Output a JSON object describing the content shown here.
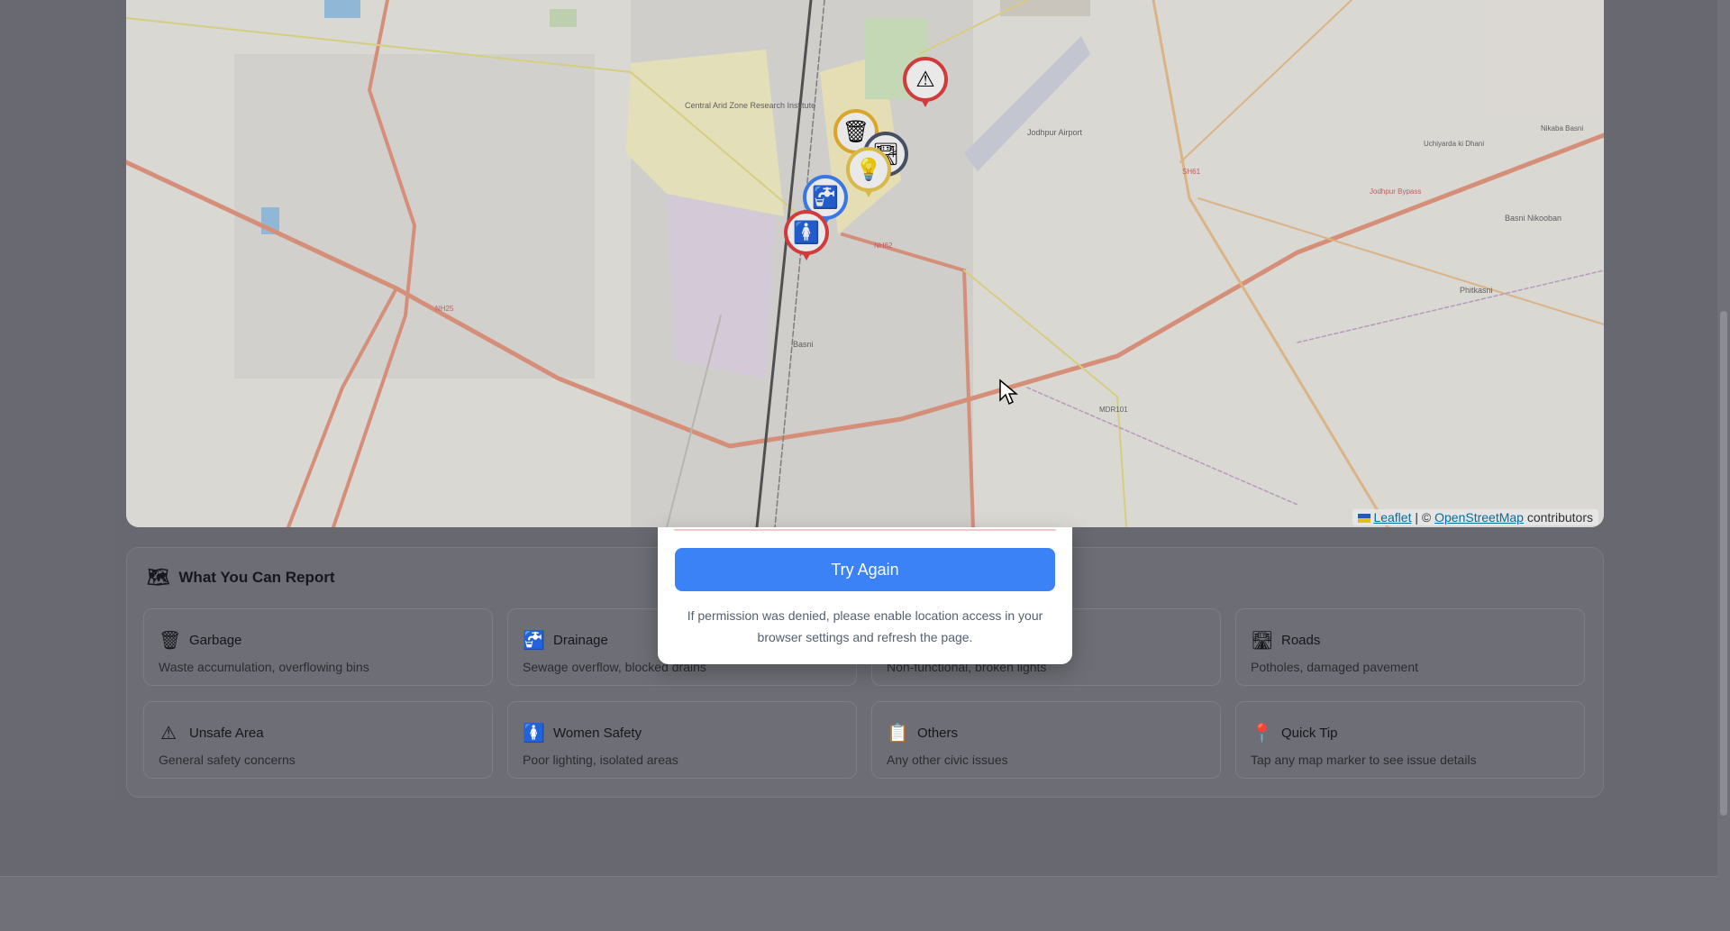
{
  "map": {
    "attribution": {
      "leaflet": "Leaflet",
      "separator": "| ©",
      "osm": "OpenStreetMap",
      "suffix": "contributors"
    },
    "place_labels": {
      "cazri": "Central Arid Zone Research Institute",
      "airport": "Jodhpur Airport",
      "basni": "Basni",
      "basni_nikooban": "Basni Nikooban",
      "phitkasni": "Phitkasni",
      "nikaba": "Nikaba Basni",
      "uchiyarda": "Uchiyarda ki Dhani",
      "jodhpur_bypass": "Jodhpur Bypass",
      "nh25": "NH25",
      "nh62": "NH62",
      "sh61": "SH61",
      "mdr101": "MDR101"
    },
    "markers": [
      {
        "name": "unsafe-area-marker",
        "glyph": "⚠",
        "color": "#e53e3e"
      },
      {
        "name": "garbage-marker",
        "glyph": "🗑",
        "color": "#f0b429"
      },
      {
        "name": "roads-marker",
        "glyph": "🛣",
        "color": "#4a5568"
      },
      {
        "name": "streetlight-marker",
        "glyph": "💡",
        "color": "#ecc94b"
      },
      {
        "name": "drainage-marker",
        "glyph": "🚰",
        "color": "#3b82f6"
      },
      {
        "name": "women-safety-marker",
        "glyph": "🚺",
        "color": "#e53e3e"
      }
    ]
  },
  "modal": {
    "button_label": "Try Again",
    "note": "If permission was denied, please enable location access in your browser settings and refresh the page."
  },
  "report": {
    "title": "What You Can Report",
    "title_icon": "map-icon",
    "cards": [
      {
        "icon": "garbage-icon",
        "glyph": "🗑",
        "title": "Garbage",
        "desc": "Waste accumulation, overflowing bins"
      },
      {
        "icon": "drainage-icon",
        "glyph": "🚰",
        "title": "Drainage",
        "desc": "Sewage overflow, blocked drains"
      },
      {
        "icon": "streetlight-icon",
        "glyph": "💡",
        "title": "",
        "desc": "Non-functional, broken lights"
      },
      {
        "icon": "roads-icon",
        "glyph": "🛣",
        "title": "Roads",
        "desc": "Potholes, damaged pavement"
      },
      {
        "icon": "warning-icon",
        "glyph": "⚠",
        "title": "Unsafe Area",
        "desc": "General safety concerns"
      },
      {
        "icon": "women-safety-icon",
        "glyph": "🚺",
        "title": "Women Safety",
        "desc": "Poor lighting, isolated areas"
      },
      {
        "icon": "clipboard-icon",
        "glyph": "📋",
        "title": "Others",
        "desc": "Any other civic issues"
      },
      {
        "icon": "pin-icon",
        "glyph": "📍",
        "title": "Quick Tip",
        "desc": "Tap any map marker to see issue details"
      }
    ]
  }
}
